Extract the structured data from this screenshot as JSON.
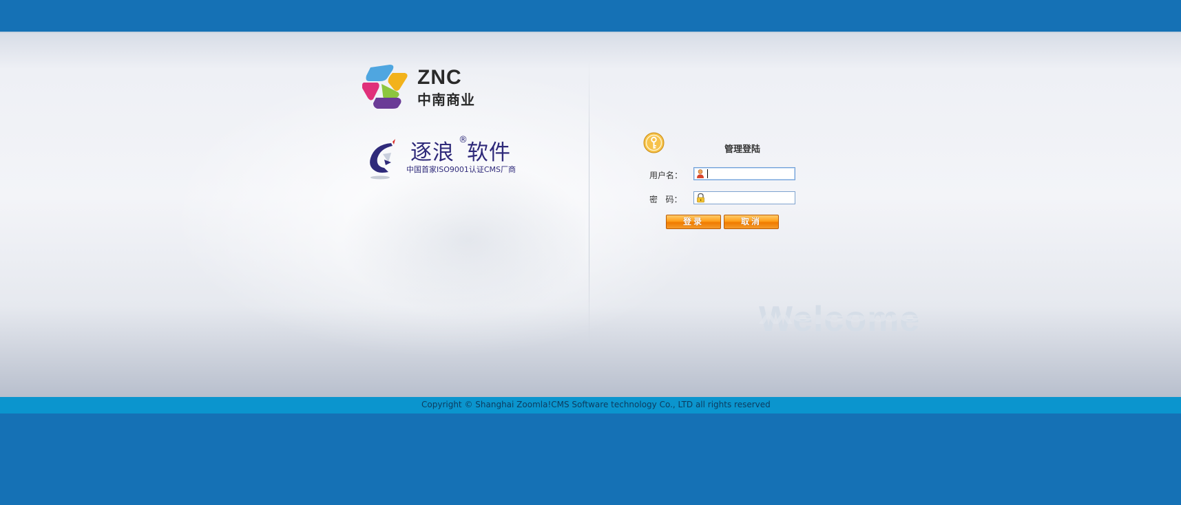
{
  "brand": {
    "znc_logo_text": "ZNC",
    "znc_logo_cn": "中南商业",
    "zhulang_name_part1": "逐浪",
    "zhulang_registered": "®",
    "zhulang_name_part2": "软件",
    "zhulang_tagline": "中国首家ISO9001认证CMS厂商"
  },
  "login": {
    "title": "管理登陆",
    "username_label": "用户名：",
    "username_value": "",
    "password_label": "密   码：",
    "password_value": "",
    "login_button": "登录",
    "cancel_button": "取消",
    "icons": {
      "panel": "key-icon",
      "username": "user-icon",
      "password": "lock-icon"
    }
  },
  "welcome_text": "Welcome",
  "footer": {
    "copyright": "Copyright © Shanghai Zoomla!CMS Software technology Co., LTD all rights reserved"
  },
  "colors": {
    "page_blue": "#1571b5",
    "footer_bar": "#0b95ce",
    "button_orange": "#ff9f1a",
    "logo_purple": "#2f2a7a"
  }
}
